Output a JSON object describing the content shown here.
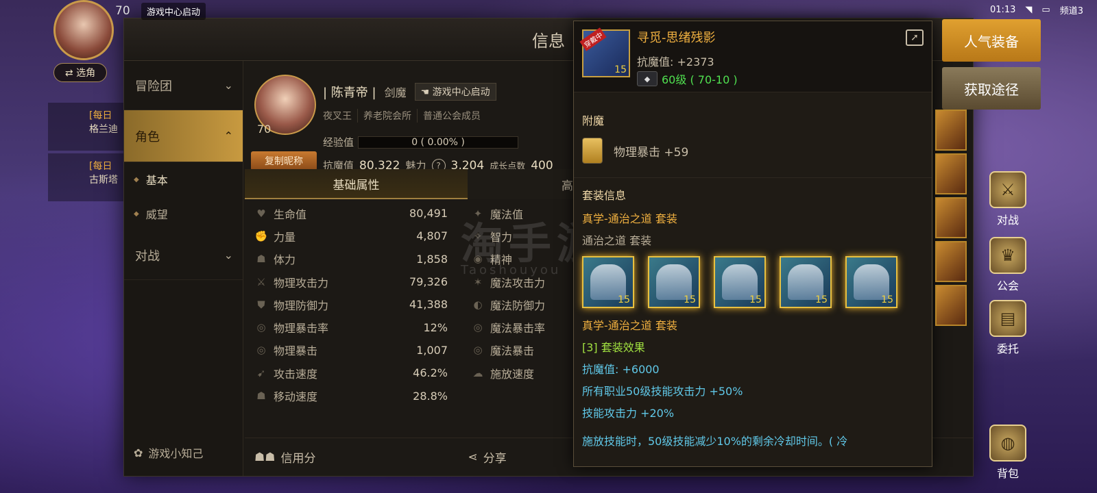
{
  "status": {
    "time": "01:13",
    "channel": "频道3"
  },
  "hud": {
    "level": "70",
    "launch_tag": "游戏中心启动",
    "switch_label": "⇄ 选角",
    "quests": [
      {
        "tag": "[每日",
        "text": "格兰迪"
      },
      {
        "tag": "[每日",
        "text": "古斯塔"
      }
    ],
    "popular_gear": "人气装备",
    "obtain_path": "获取途径",
    "battle": "对战",
    "guild": "公会",
    "commission": "委托",
    "bag": "背包"
  },
  "panel": {
    "title": "信息",
    "nav": {
      "adventure": "冒险团",
      "character": "角色",
      "basic": "基本",
      "prestige": "威望",
      "battle": "对战",
      "trivia": "游戏小知己"
    },
    "character": {
      "level": "70",
      "name": "| 陈青帝 |",
      "class": "剑魔",
      "launch": "游戏中心启动",
      "title": "夜叉王",
      "guild": "养老院会所",
      "guild_role": "普通公会成员",
      "copy_label": "复制昵称",
      "exp_label": "经验值",
      "exp_value": "0 ( 0.00% )",
      "resist_label": "抗魔值",
      "resist_value": "80,322",
      "charm_label": "魅力",
      "charm_value": "3,204",
      "growth_label": "成长点数",
      "growth_value": "400"
    },
    "tabs": [
      "基础属性",
      "高级属"
    ],
    "attrs_left": [
      {
        "icon": "♥",
        "name": "生命值",
        "value": "80,491"
      },
      {
        "icon": "✊",
        "name": "力量",
        "value": "4,807"
      },
      {
        "icon": "☗",
        "name": "体力",
        "value": "1,858"
      },
      {
        "icon": "⚔",
        "name": "物理攻击力",
        "value": "79,326"
      },
      {
        "icon": "⛊",
        "name": "物理防御力",
        "value": "41,388"
      },
      {
        "icon": "◎",
        "name": "物理暴击率",
        "value": "12%"
      },
      {
        "icon": "◎",
        "name": "物理暴击",
        "value": "1,007"
      },
      {
        "icon": "➹",
        "name": "攻击速度",
        "value": "46.2%"
      },
      {
        "icon": "☗",
        "name": "移动速度",
        "value": "28.8%"
      }
    ],
    "attrs_right": [
      {
        "icon": "✦",
        "name": "魔法值"
      },
      {
        "icon": "✧",
        "name": "智力"
      },
      {
        "icon": "◉",
        "name": "精神"
      },
      {
        "icon": "✶",
        "name": "魔法攻击力"
      },
      {
        "icon": "◐",
        "name": "魔法防御力"
      },
      {
        "icon": "◎",
        "name": "魔法暴击率"
      },
      {
        "icon": "◎",
        "name": "魔法暴击"
      },
      {
        "icon": "☁",
        "name": "施放速度"
      }
    ],
    "bottom": {
      "credit": "信用分",
      "share": "分享"
    }
  },
  "tooltip": {
    "item_name": "寻觅-思绪残影",
    "item_badge": "穿戴中",
    "item_lv": "15",
    "resist": "抗魔值: +2373",
    "level": "60级 ( 70-10 )",
    "enchant_title": "附魔",
    "enchant_text": "物理暴击 +59",
    "set_info_title": "套装信息",
    "set_name": "真学-通治之道 套装",
    "set_sub": "通治之道 套装",
    "set_icon_lv": "15",
    "set_name2": "真学-通治之道 套装",
    "set_effect": "[3] 套装效果",
    "eff1": "抗魔值: +6000",
    "eff2": "所有职业50级技能攻击力 +50%",
    "eff3": "技能攻击力 +20%",
    "desc": "施放技能时，50级技能减少10%的剩余冷却时间。( 冷"
  },
  "watermark": {
    "cn": "淘手游",
    "en": "Taoshouyou"
  }
}
